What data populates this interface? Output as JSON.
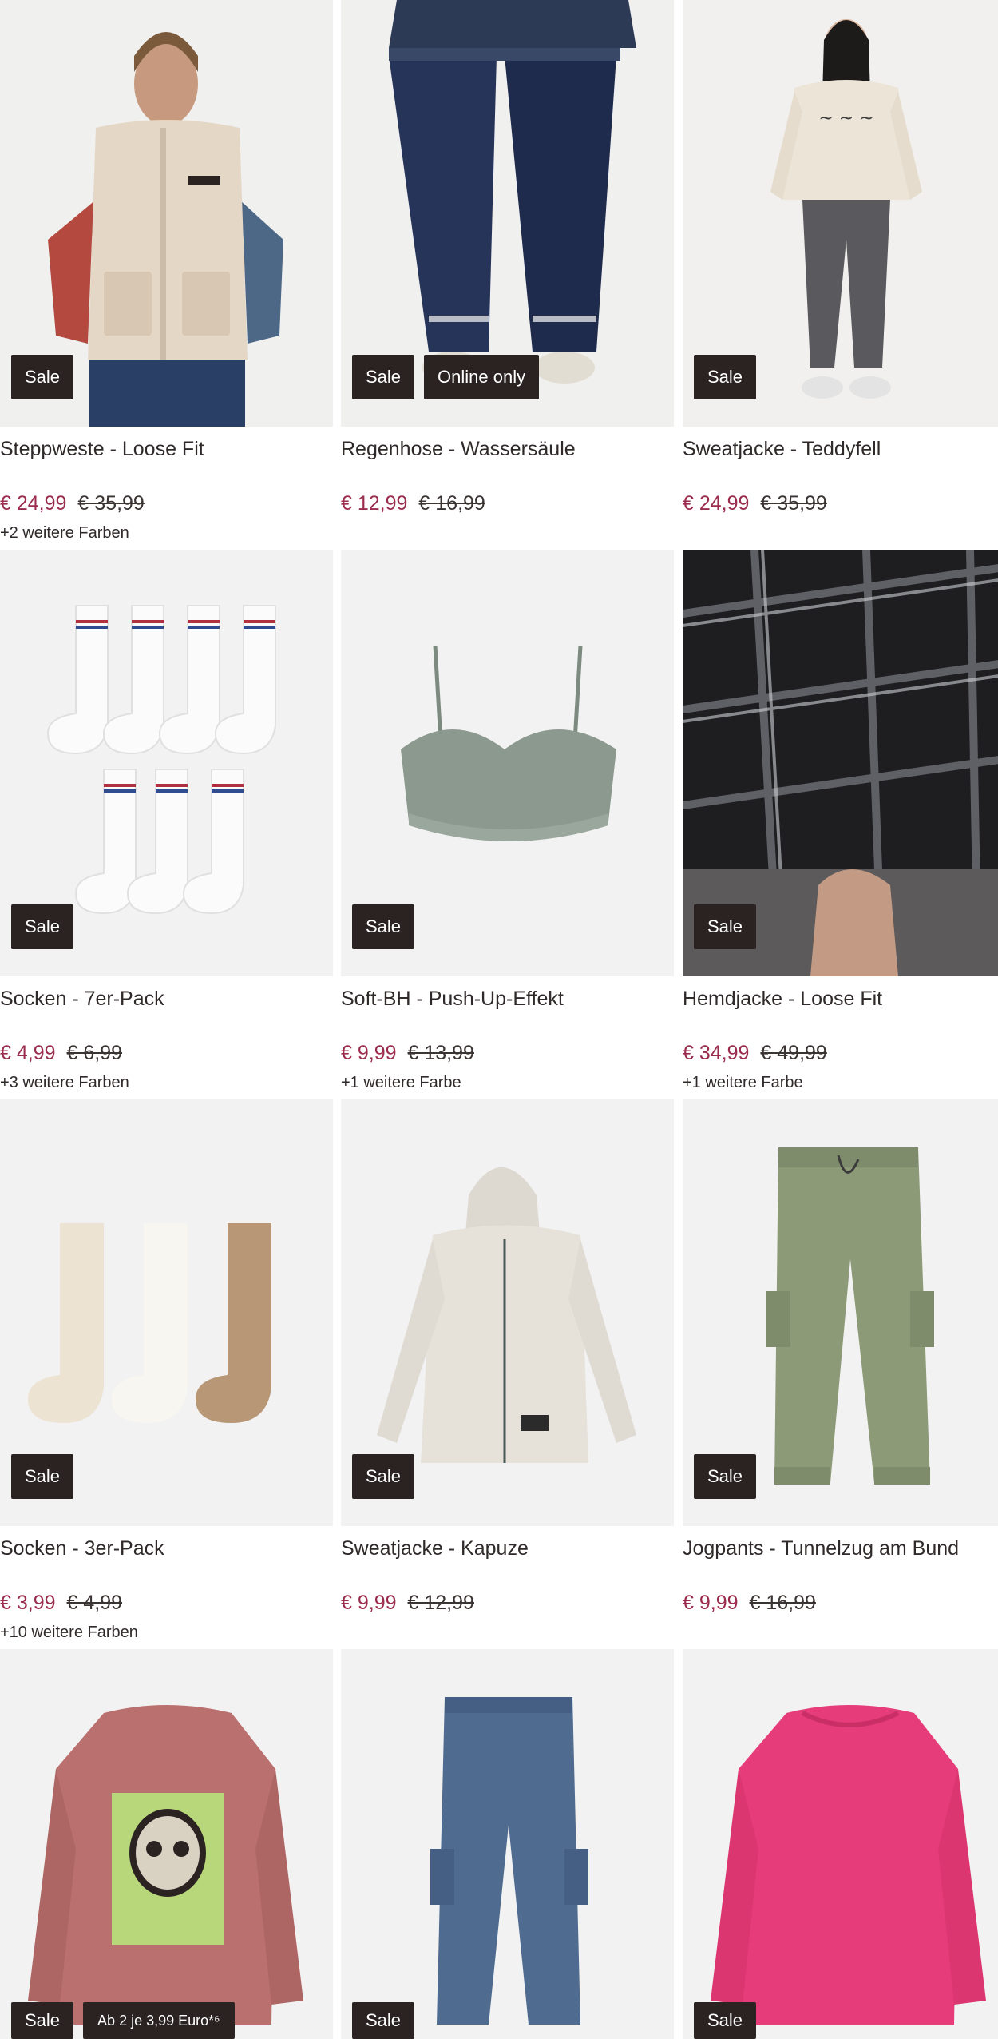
{
  "accent_price_color": "#9b2c4d",
  "badge_color": "#2b2322",
  "products": [
    {
      "title": "Steppweste - Loose Fit",
      "price": "€ 24,99",
      "old_price": "€ 35,99",
      "colors": "+2 weitere Farben",
      "badges": [
        "Sale"
      ]
    },
    {
      "title": "Regenhose - Wassersäule",
      "price": "€ 12,99",
      "old_price": "€ 16,99",
      "colors": "",
      "badges": [
        "Sale",
        "Online only"
      ]
    },
    {
      "title": "Sweatjacke - Teddyfell",
      "price": "€ 24,99",
      "old_price": "€ 35,99",
      "colors": "",
      "badges": [
        "Sale"
      ]
    },
    {
      "title": "Socken - 7er-Pack",
      "price": "€ 4,99",
      "old_price": "€ 6,99",
      "colors": "+3 weitere Farben",
      "badges": [
        "Sale"
      ]
    },
    {
      "title": "Soft-BH - Push-Up-Effekt",
      "price": "€ 9,99",
      "old_price": "€ 13,99",
      "colors": "+1 weitere Farbe",
      "badges": [
        "Sale"
      ]
    },
    {
      "title": "Hemdjacke - Loose Fit",
      "price": "€ 34,99",
      "old_price": "€ 49,99",
      "colors": "+1 weitere Farbe",
      "badges": [
        "Sale"
      ]
    },
    {
      "title": "Socken - 3er-Pack",
      "price": "€ 3,99",
      "old_price": "€ 4,99",
      "colors": "+10 weitere Farben",
      "badges": [
        "Sale"
      ]
    },
    {
      "title": "Sweatjacke - Kapuze",
      "price": "€ 9,99",
      "old_price": "€ 12,99",
      "colors": "",
      "badges": [
        "Sale"
      ]
    },
    {
      "title": "Jogpants - Tunnelzug am Bund",
      "price": "€ 9,99",
      "old_price": "€ 16,99",
      "colors": "",
      "badges": [
        "Sale"
      ]
    },
    {
      "title": "",
      "price": "",
      "old_price": "",
      "colors": "",
      "badges": [
        "Sale",
        "Ab 2 je 3,99 Euro*⁶"
      ]
    },
    {
      "title": "",
      "price": "",
      "old_price": "",
      "colors": "",
      "badges": [
        "Sale"
      ]
    },
    {
      "title": "",
      "price": "",
      "old_price": "",
      "colors": "",
      "badges": [
        "Sale"
      ]
    }
  ]
}
